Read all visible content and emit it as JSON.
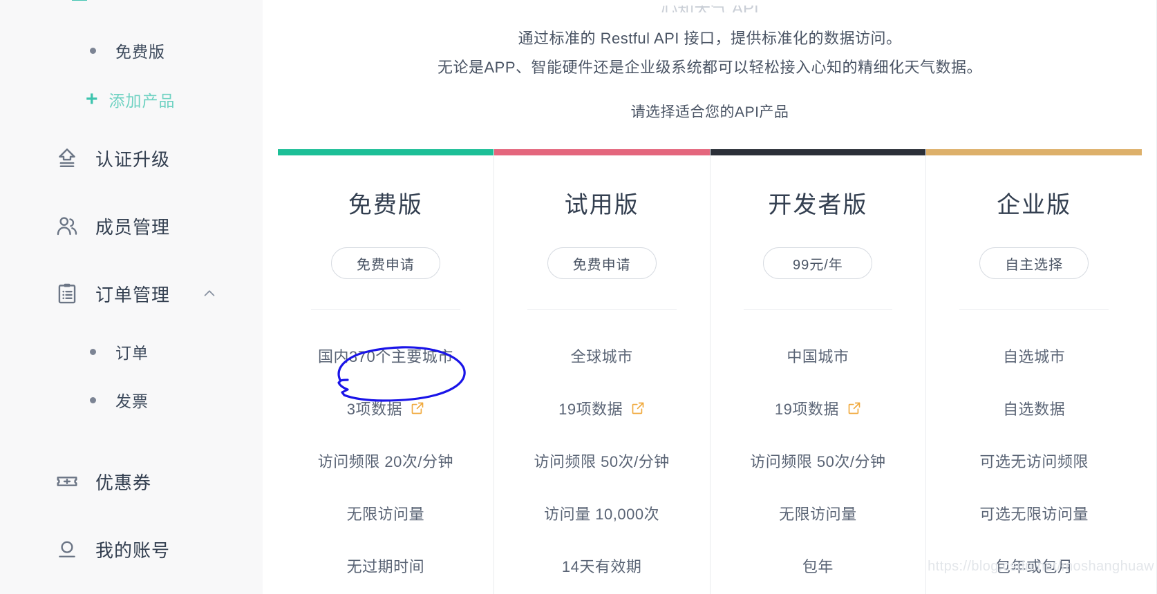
{
  "sidebar": {
    "logo_name": "xinzhi-logo",
    "items": [
      {
        "type": "sub",
        "label": "免费版",
        "name": "sidebar-subitem-free-edition"
      },
      {
        "type": "add",
        "label": "添加产品",
        "name": "sidebar-add-product"
      },
      {
        "type": "top",
        "label": "认证升级",
        "icon": "upgrade-icon",
        "name": "sidebar-item-certification-upgrade",
        "chevron": ""
      },
      {
        "type": "top",
        "label": "成员管理",
        "icon": "members-icon",
        "name": "sidebar-item-member-management",
        "chevron": ""
      },
      {
        "type": "top",
        "label": "订单管理",
        "icon": "clipboard-icon",
        "name": "sidebar-item-order-management",
        "chevron": "chevron-up-icon"
      },
      {
        "type": "sub",
        "label": "订单",
        "name": "sidebar-subitem-orders"
      },
      {
        "type": "sub",
        "label": "发票",
        "name": "sidebar-subitem-invoices"
      },
      {
        "type": "top",
        "label": "优惠券",
        "icon": "coupon-icon",
        "name": "sidebar-item-coupons",
        "chevron": ""
      },
      {
        "type": "top",
        "label": "我的账号",
        "icon": "account-icon",
        "name": "sidebar-item-my-account",
        "chevron": ""
      }
    ]
  },
  "intro": {
    "clipped_title": "心知天气 API",
    "lead_line1": "通过标准的 Restful API 接口，提供标准化的数据访问。",
    "lead_line2": "无论是APP、智能硬件还是企业级系统都可以轻松接入心知的精细化天气数据。",
    "choose_line": "请选择适合您的API产品"
  },
  "plans": [
    {
      "name": "免费版",
      "accent": "#1cbf97",
      "cta": "免费申请",
      "features": [
        {
          "text": "国内370个主要城市",
          "ext": false
        },
        {
          "text": "3项数据",
          "ext": true
        },
        {
          "text": "访问频限 20次/分钟",
          "ext": false
        },
        {
          "text": "无限访问量",
          "ext": false
        },
        {
          "text": "无过期时间",
          "ext": false
        }
      ]
    },
    {
      "name": "试用版",
      "accent": "#e4667d",
      "cta": "免费申请",
      "features": [
        {
          "text": "全球城市",
          "ext": false
        },
        {
          "text": "19项数据",
          "ext": true
        },
        {
          "text": "访问频限 50次/分钟",
          "ext": false
        },
        {
          "text": "访问量 10,000次",
          "ext": false
        },
        {
          "text": "14天有效期",
          "ext": false
        }
      ]
    },
    {
      "name": "开发者版",
      "accent": "#2b2f38",
      "cta": "99元/年",
      "features": [
        {
          "text": "中国城市",
          "ext": false
        },
        {
          "text": "19项数据",
          "ext": true
        },
        {
          "text": "访问频限 50次/分钟",
          "ext": false
        },
        {
          "text": "无限访问量",
          "ext": false
        },
        {
          "text": "包年",
          "ext": false
        }
      ]
    },
    {
      "name": "企业版",
      "accent": "#ddb06a",
      "cta": "自主选择",
      "features": [
        {
          "text": "自选城市",
          "ext": false
        },
        {
          "text": "自选数据",
          "ext": false
        },
        {
          "text": "可选无访问频限",
          "ext": false
        },
        {
          "text": "可选无限访问量",
          "ext": false
        },
        {
          "text": "包年或包月",
          "ext": false
        }
      ]
    }
  ],
  "annotation": {
    "name": "handdrawn-circle-annotation",
    "color": "#1a14e8",
    "target": "3项数据"
  },
  "watermark": {
    "text": "https://blog.csdn.net/moshanghuaw"
  }
}
